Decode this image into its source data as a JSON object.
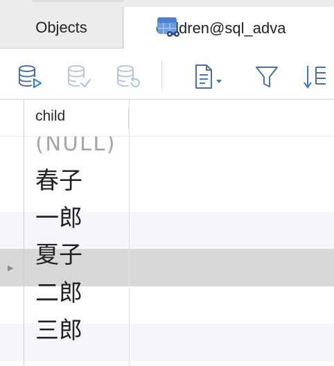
{
  "tabs": {
    "objects_label": "Objects",
    "active_label": "children@sql_adva"
  },
  "toolbar": {
    "buttons": [
      {
        "name": "begin-transaction",
        "enabled": true
      },
      {
        "name": "commit",
        "enabled": false
      },
      {
        "name": "rollback",
        "enabled": false
      },
      {
        "name": "text-view",
        "enabled": true
      },
      {
        "name": "filter",
        "enabled": true
      },
      {
        "name": "sort",
        "enabled": true
      }
    ]
  },
  "grid": {
    "columns": [
      "child"
    ],
    "rows": [
      {
        "value": "(NULL)",
        "is_null": true
      },
      {
        "value": "春子"
      },
      {
        "value": "一郎"
      },
      {
        "value": "夏子",
        "selected": true
      },
      {
        "value": "二郎"
      },
      {
        "value": "三郎"
      }
    ],
    "row_marker": "▶"
  },
  "colors": {
    "accent": "#2f7bd9",
    "selected_row": "#d8d8d8",
    "alt_row": "#f4f6fa",
    "null_text": "#a6a6a6"
  }
}
